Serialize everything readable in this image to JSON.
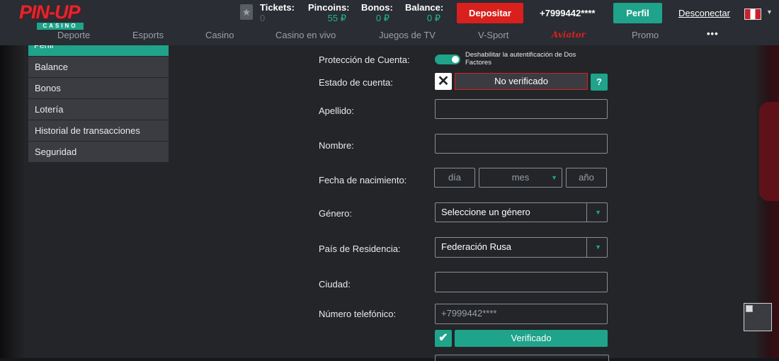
{
  "header": {
    "logo": {
      "main": "PIN-UP",
      "sub": "CASINO"
    },
    "stats": {
      "tickets": {
        "label": "Tickets:",
        "value": "0"
      },
      "pincoins": {
        "label": "Pincoins:",
        "value": "55 ₽"
      },
      "bonos": {
        "label": "Bonos:",
        "value": "0 ₽"
      },
      "balance": {
        "label": "Balance:",
        "value": "0 ₽"
      }
    },
    "deposit_label": "Depositar",
    "phone": "+7999442****",
    "profile_label": "Perfil",
    "logout_label": "Desconectar",
    "language_flag": "flag-peru"
  },
  "nav": {
    "items": [
      "Deporte",
      "Esports",
      "Casino",
      "Casino en vivo",
      "Juegos de TV",
      "V-Sport",
      "Aviator",
      "Promo"
    ],
    "more": "•••"
  },
  "sidebar": {
    "active": "Perfil",
    "items": [
      "Balance",
      "Bonos",
      "Lotería",
      "Historial de transacciones",
      "Seguridad"
    ]
  },
  "form": {
    "account_protection": {
      "label": "Protección de Cuenta:",
      "toggle_text": "Deshabilitar la autentificación de Dos Factores"
    },
    "account_status": {
      "label": "Estado de cuenta:",
      "value": "No verificado",
      "help": "?"
    },
    "surname": {
      "label": "Apellido:",
      "value": ""
    },
    "name": {
      "label": "Nombre:",
      "value": ""
    },
    "birthdate": {
      "label": "Fecha de nacimiento:",
      "day_placeholder": "día",
      "month_placeholder": "mes",
      "year_placeholder": "año"
    },
    "gender": {
      "label": "Género:",
      "value": "Seleccione un género"
    },
    "country": {
      "label": "País de Residencia:",
      "value": "Federación Rusa"
    },
    "city": {
      "label": "Ciudad:",
      "value": ""
    },
    "phone": {
      "label": "Número telefónico:",
      "value": "+7999442****",
      "verified_label": "Verificado"
    }
  },
  "colors": {
    "accent": "#1fa38a",
    "danger": "#d9201d",
    "panel": "#232529",
    "header": "#2a2d33"
  }
}
